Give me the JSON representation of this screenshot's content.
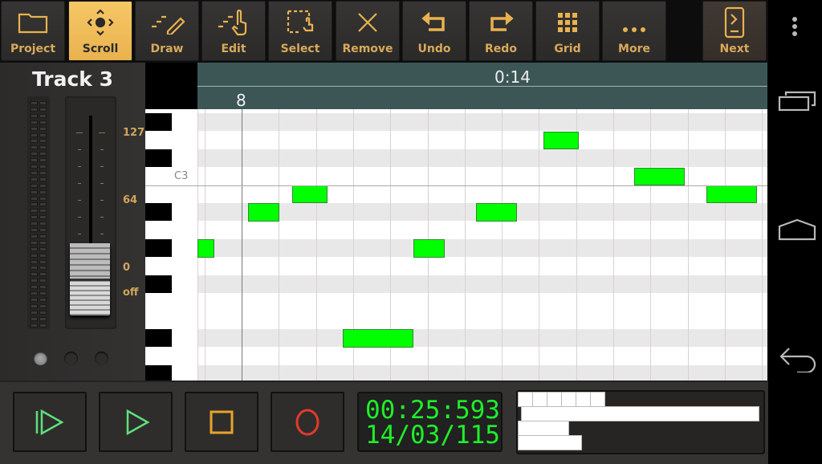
{
  "toolbar": {
    "buttons": [
      {
        "label": "Project",
        "icon": "folder-icon"
      },
      {
        "label": "Scroll",
        "icon": "scroll-move-icon",
        "active": true
      },
      {
        "label": "Draw",
        "icon": "pencil-icon"
      },
      {
        "label": "Edit",
        "icon": "hand-pointer-icon"
      },
      {
        "label": "Select",
        "icon": "selection-box-icon"
      },
      {
        "label": "Remove",
        "icon": "x-icon"
      },
      {
        "label": "Undo",
        "icon": "undo-arrow-icon"
      },
      {
        "label": "Redo",
        "icon": "redo-arrow-icon"
      },
      {
        "label": "Grid",
        "icon": "grid-icon"
      },
      {
        "label": "More",
        "icon": "more-dots-icon"
      }
    ],
    "next_label": "Next"
  },
  "colors": {
    "accent": "#e9b24e",
    "note": "#00ff00",
    "lcd_text": "#1fef2a",
    "ruler": "#3c5656"
  },
  "track": {
    "title": "Track 3",
    "scale_labels": [
      "127",
      "64",
      "0",
      "off"
    ],
    "fader_value": "0"
  },
  "piano_roll": {
    "key_label": "C3",
    "ruler_time": "0:14",
    "ruler_bar": "8",
    "notes": [
      {
        "start_beat": 0.0,
        "length_beats": 0.45,
        "pitch_offset_from_C3": -4
      },
      {
        "start_beat": 1.35,
        "length_beats": 0.85,
        "pitch_offset_from_C3": -2
      },
      {
        "start_beat": 2.55,
        "length_beats": 0.95,
        "pitch_offset_from_C3": -1
      },
      {
        "start_beat": 3.9,
        "length_beats": 1.9,
        "pitch_offset_from_C3": -9
      },
      {
        "start_beat": 5.8,
        "length_beats": 0.85,
        "pitch_offset_from_C3": -4
      },
      {
        "start_beat": 7.5,
        "length_beats": 1.1,
        "pitch_offset_from_C3": -2
      },
      {
        "start_beat": 9.3,
        "length_beats": 0.95,
        "pitch_offset_from_C3": 2
      },
      {
        "start_beat": 11.75,
        "length_beats": 1.35,
        "pitch_offset_from_C3": 0
      },
      {
        "start_beat": 13.7,
        "length_beats": 1.35,
        "pitch_offset_from_C3": -1
      }
    ]
  },
  "transport": {
    "time": "00:25:593",
    "position": "14/03/115",
    "buttons": [
      "play-from-start",
      "play",
      "stop",
      "record"
    ]
  },
  "overview": {
    "blocks": 6
  },
  "system_nav": [
    "overflow-menu",
    "recent-apps",
    "home",
    "back"
  ]
}
